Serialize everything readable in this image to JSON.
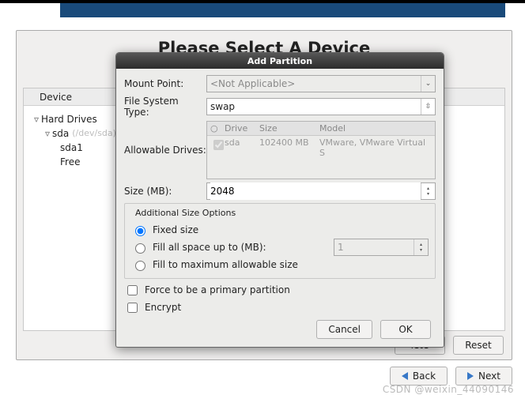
{
  "background": {
    "title": "Please Select A Device",
    "device_col": "Device",
    "tree": {
      "hard_drives": "Hard Drives",
      "sda": "sda",
      "sda_hint": "(/dev/sda)",
      "sda1": "sda1",
      "free": "Free"
    },
    "buttons": {
      "delete": "lete",
      "reset": "Reset",
      "back": "Back",
      "next": "Next"
    }
  },
  "modal": {
    "title": "Add Partition",
    "labels": {
      "mount_point": "Mount Point:",
      "fs_type": "File System Type:",
      "allowable": "Allowable Drives:",
      "size": "Size (MB):",
      "additional": "Additional Size Options",
      "fixed": "Fixed size",
      "fill_up": "Fill all space up to (MB):",
      "fill_max": "Fill to maximum allowable size",
      "force_primary": "Force to be a primary partition",
      "encrypt": "Encrypt"
    },
    "values": {
      "mount_point": "<Not Applicable>",
      "fs_type": "swap",
      "size": "2048",
      "fill_up_val": "1"
    },
    "drives": {
      "head": {
        "check": "",
        "drive": "Drive",
        "size": "Size",
        "model": "Model"
      },
      "rows": [
        {
          "drive": "sda",
          "size": "102400 MB",
          "model": "VMware, VMware Virtual S"
        }
      ]
    },
    "buttons": {
      "cancel": "Cancel",
      "ok": "OK"
    }
  },
  "watermark": "CSDN @weixin_44090146"
}
